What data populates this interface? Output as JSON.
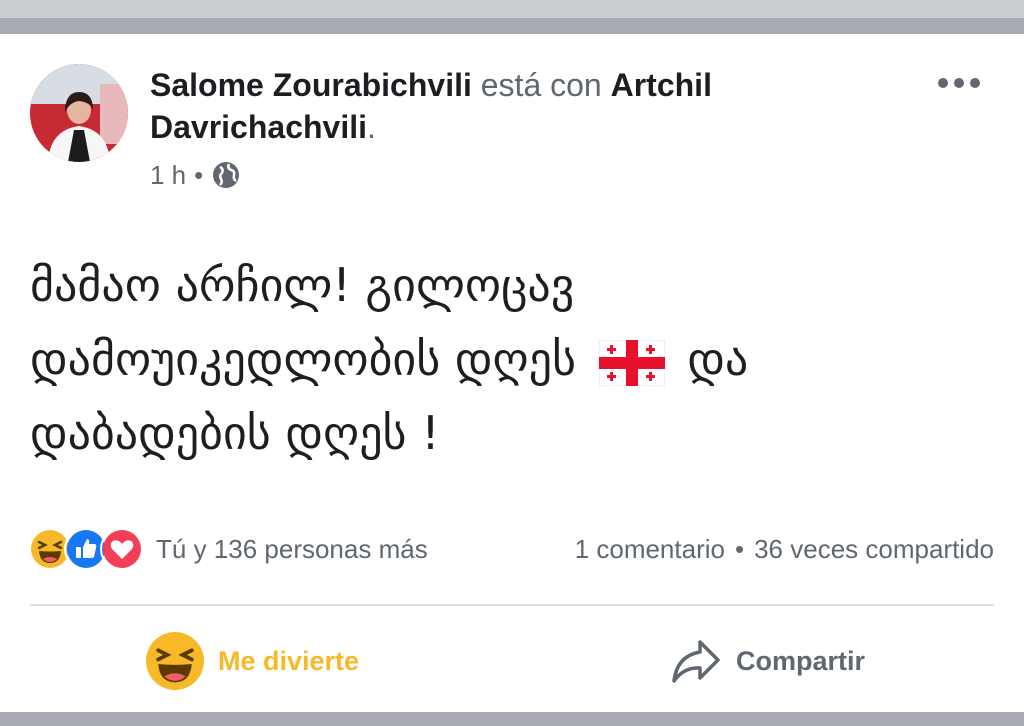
{
  "post": {
    "author_name": "Salome Zourabichvili",
    "connector": "está con",
    "tagged_name": "Artchil Davrichachvili",
    "trailing_period": ".",
    "time": "1 h",
    "meta_separator": "•",
    "privacy_icon": "globe-icon",
    "body_part1": "მამაო არჩილ!  გილოცავ დამოუიკედლობის დღეს",
    "body_part2": "და დაბადების დღეს !",
    "flag_icon": "georgian-flag-icon"
  },
  "reactions": {
    "icons": [
      "haha-icon",
      "like-icon",
      "love-icon"
    ],
    "summary": "Tú y 136 personas más",
    "comments": "1 comentario",
    "separator": "•",
    "shares": "36 veces compartido"
  },
  "actions": {
    "react_label": "Me divierte",
    "share_label": "Compartir"
  },
  "colors": {
    "haha": "#f7b928",
    "like": "#1877f2",
    "love": "#f33e58",
    "text": "#1c1e21",
    "muted": "#606770"
  }
}
